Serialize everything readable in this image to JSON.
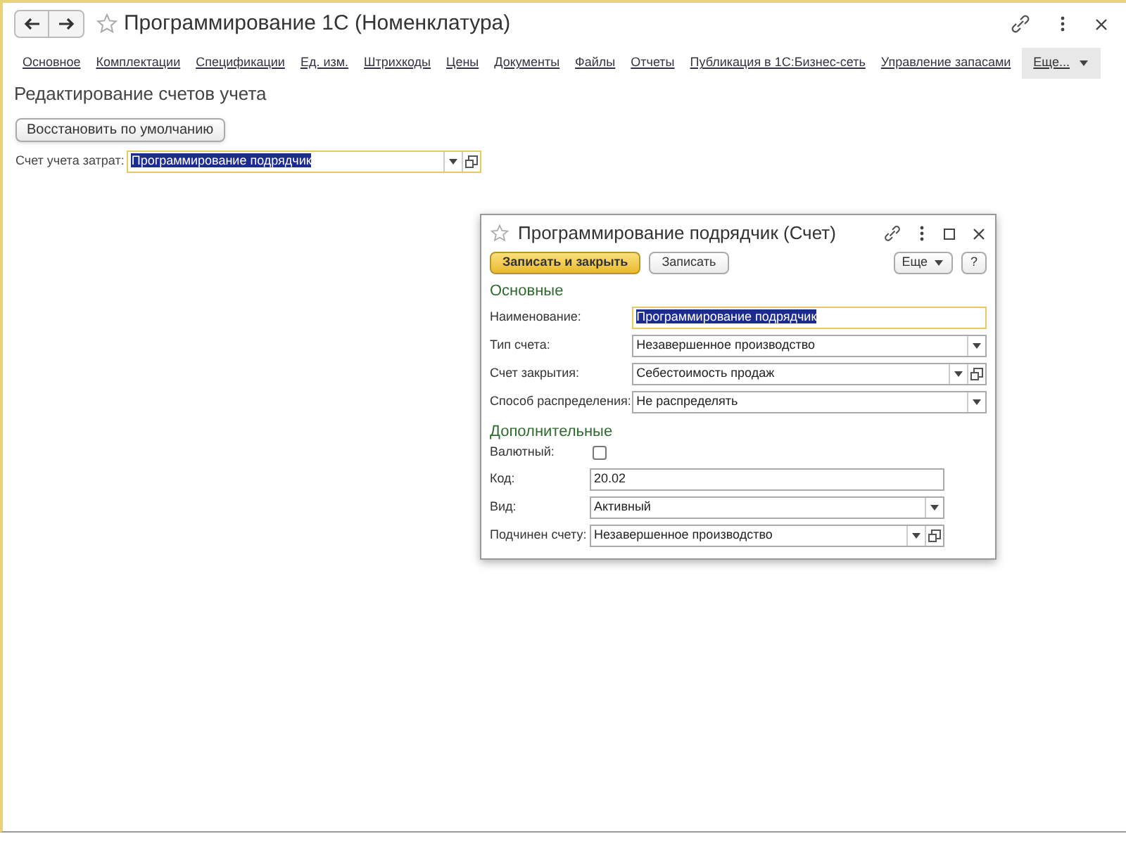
{
  "window": {
    "title": "Программирование 1С (Номенклатура)"
  },
  "tabs": [
    {
      "label": "Основное"
    },
    {
      "label": "Комплектации"
    },
    {
      "label": "Спецификации"
    },
    {
      "label": "Ед. изм."
    },
    {
      "label": "Штрихкоды"
    },
    {
      "label": "Цены"
    },
    {
      "label": "Документы"
    },
    {
      "label": "Файлы"
    },
    {
      "label": "Отчеты"
    },
    {
      "label": "Публикация в 1С:Бизнес-сеть"
    },
    {
      "label": "Управление запасами"
    }
  ],
  "more_menu": {
    "label": "Еще..."
  },
  "section_title": "Редактирование счетов учета",
  "restore_button": "Восстановить по умолчанию",
  "cost_account": {
    "label": "Счет учета затрат:",
    "value": "Программирование подрядчик",
    "highlighted": true
  },
  "dialog": {
    "title": "Программирование подрядчик (Счет)",
    "buttons": [
      {
        "label": "Записать и закрыть",
        "default": true
      },
      {
        "label": "Записать",
        "default": false
      }
    ],
    "more_button": "Еще",
    "help_button": "?",
    "groups": [
      {
        "title": "Основные",
        "fields": [
          {
            "kind": "text",
            "label": "Наименование:",
            "value": "Программирование подрядчик",
            "highlighted": true
          },
          {
            "kind": "select",
            "label": "Тип счета:",
            "value": "Незавершенное производство",
            "highlighted": false
          },
          {
            "kind": "select_open",
            "label": "Счет закрытия:",
            "value": "Себестоимость продаж",
            "highlighted": false
          },
          {
            "kind": "select",
            "label": "Способ распределения:",
            "value": "Не распределять",
            "highlighted": false
          }
        ]
      },
      {
        "title": "Дополнительные",
        "fields": [
          {
            "kind": "checkbox",
            "label": "Валютный:",
            "checked": false
          },
          {
            "kind": "text",
            "label": "Код:",
            "value": "20.02",
            "highlighted": false
          },
          {
            "kind": "select",
            "label": "Вид:",
            "value": "Активный",
            "highlighted": false
          },
          {
            "kind": "select_open",
            "label": "Подчинен счету:",
            "value": "Незавершенное производство",
            "highlighted": false
          }
        ]
      }
    ]
  }
}
